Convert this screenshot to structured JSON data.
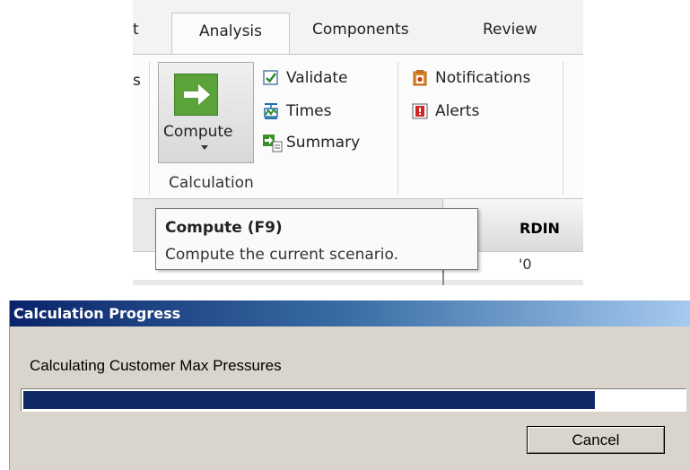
{
  "ribbon": {
    "tabs": {
      "partial_left": "t",
      "analysis": "Analysis",
      "components": "Components",
      "review": "Review"
    },
    "left_partial_glyph": "s",
    "calculation_group": {
      "compute_label": "Compute",
      "items": {
        "validate": "Validate",
        "times": "Times",
        "summary": "Summary",
        "notifications": "Notifications",
        "alerts": "Alerts"
      },
      "group_label": "Calculation"
    }
  },
  "grid": {
    "column_header_partial": "RDIN",
    "cell_value_partial": "'0"
  },
  "tooltip": {
    "title": "Compute (F9)",
    "description": "Compute the current scenario."
  },
  "dialog": {
    "title": "Calculation Progress",
    "status_text": "Calculating Customer Max Pressures",
    "progress_fraction": 0.865,
    "cancel_label": "Cancel"
  },
  "colors": {
    "compute_green": "#5aa33a",
    "progress_fill": "#0f2a66",
    "dialog_bg": "#d9d5cd"
  },
  "icons": {
    "compute": "arrow-right-icon",
    "validate": "checkbox-icon",
    "times": "graph-icon",
    "summary": "summary-arrow-icon",
    "notifications": "notification-icon",
    "alerts": "alert-icon"
  }
}
